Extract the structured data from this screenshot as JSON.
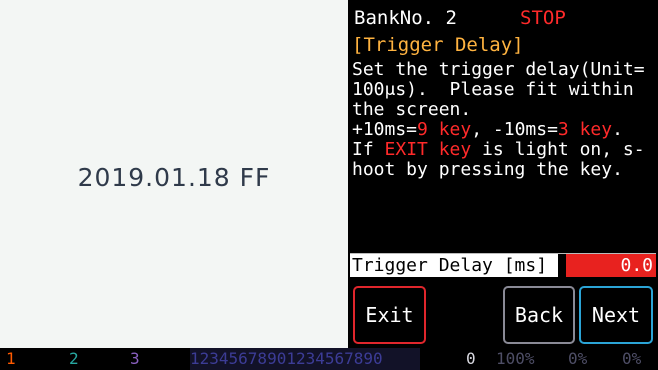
{
  "preview": {
    "stamp": "2019.01.18 FF"
  },
  "header": {
    "bank": "BankNo. 2",
    "status": "STOP"
  },
  "section_title": "[Trigger Delay]",
  "instructions": {
    "line1": "Set the trigger delay(Unit=",
    "line2": "100μs).  Please fit within",
    "line3": "the screen.",
    "line4a": "+10ms=",
    "line4b": "9 key",
    "line4c": ", -10ms=",
    "line4d": "3 key",
    "line4e": ".",
    "line5a": "If ",
    "line5b": "EXIT key",
    "line5c": " is light on, s-",
    "line6": "hoot by pressing the key."
  },
  "delay": {
    "label": "Trigger Delay [ms]",
    "value": "0.0"
  },
  "buttons": {
    "exit": "Exit",
    "back": "Back",
    "next": "Next"
  },
  "statusbar": {
    "seg1": "1",
    "seg2": "2",
    "seg3": "3",
    "digits": "12345678901234567890",
    "zero": "0",
    "pct1": "100%",
    "pct2": "0%",
    "pct3": "0%"
  },
  "colors": {
    "accent_red": "#e8221f",
    "title_orange": "#ffb340",
    "next_blue": "#2ba4d6",
    "exit_red": "#e0262c"
  }
}
